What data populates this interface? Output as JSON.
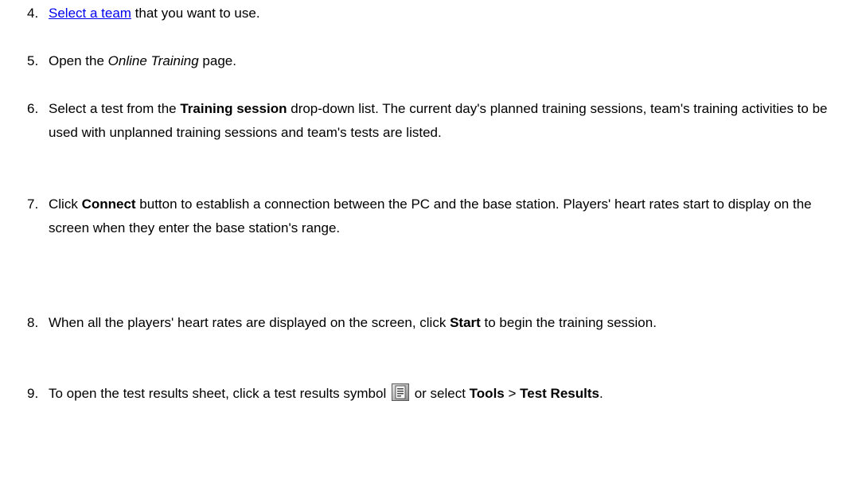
{
  "steps": [
    {
      "number": "4.",
      "link": "Select a team",
      "text": " that you want to use."
    },
    {
      "number": "5.",
      "text_before": "Open the ",
      "em": "Online Training",
      "text_after": " page."
    },
    {
      "number": "6.",
      "text_before": "Select a test from the ",
      "strong": "Training session",
      "text_after": " drop-down list. The current day's planned training sessions, team's training activities to be used with unplanned training sessions and team's tests are listed."
    },
    {
      "number": "7.",
      "text_before": "Click ",
      "strong": "Connect",
      "text_after": " button to establish a connection between the PC and the base station. Players' heart rates start to display on the screen when they enter the base station's range."
    },
    {
      "number": "8.",
      "text_before": "When all the players' heart rates are displayed on the screen, click ",
      "strong": "Start",
      "text_after": " to begin the training session."
    },
    {
      "number": "9.",
      "text_before": "To open the test results sheet, click a test results symbol ",
      "icon": "test-results-icon",
      "text_middle": " or select ",
      "strong1": "Tools",
      "sep": " > ",
      "strong2": "Test Results",
      "text_after": "."
    }
  ]
}
